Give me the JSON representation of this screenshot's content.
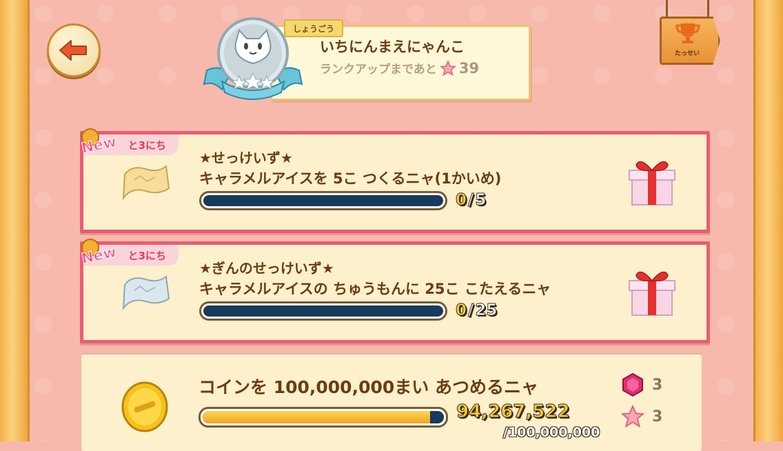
{
  "rank": {
    "tag": "しょうごう",
    "title": "いちにんまえにゃんこ",
    "sub_label": "ランクアップまであと",
    "remaining": "39"
  },
  "achievements_label": "たっせい",
  "missions": [
    {
      "badge": "New",
      "days_left": "と3にち",
      "title": "★せっけいず★",
      "desc": "キャラメルアイスを 5こ つくるニャ(1かいめ)",
      "current": "0",
      "slash": "/",
      "goal": "5",
      "progress_fraction": 0,
      "scroll_type": "gold",
      "reward_icon": "gift-icon"
    },
    {
      "badge": "New",
      "days_left": "と3にち",
      "title": "★ぎんのせっけいず★",
      "desc": "キャラメルアイスの ちゅうもんに 25こ こたえるニャ",
      "current": "0",
      "slash": "/",
      "goal": "25",
      "progress_fraction": 0,
      "scroll_type": "silver",
      "reward_icon": "gift-icon"
    }
  ],
  "coin_mission": {
    "desc": "コインを 100,000,000まい あつめるニャ",
    "current": "94,267,522",
    "goal": "/100,000,000",
    "progress_fraction": 0.943,
    "rewards": [
      {
        "icon": "gem-icon",
        "count": "3"
      },
      {
        "icon": "star-icon",
        "count": "3"
      }
    ]
  },
  "colors": {
    "card_border": "#ec5b72",
    "card_bg": "#fcf0cd",
    "bar_track": "#173b5a",
    "text_brown": "#6b3d12"
  }
}
